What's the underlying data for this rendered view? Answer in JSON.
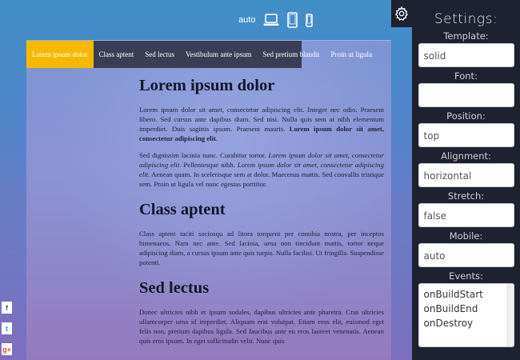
{
  "device_bar": {
    "auto_label": "auto",
    "icons": [
      "desktop-icon",
      "tablet-icon",
      "phone-icon"
    ]
  },
  "menu": {
    "items": [
      {
        "label": "Lorem ipsum dolor",
        "active": true
      },
      {
        "label": "Class aptent",
        "active": false
      },
      {
        "label": "Sed lectus",
        "active": false
      },
      {
        "label": "Vestibulum ante ipsum",
        "active": false
      },
      {
        "label": "Sed pretium blandit",
        "active": false
      },
      {
        "label": "Proin ut ligula",
        "active": false
      }
    ],
    "active_color": "#f6b900",
    "bar_color": "#3b3d55"
  },
  "article": {
    "s1": {
      "heading": "Lorem ipsum dolor",
      "p1_text": "Lorem ipsum dolor sit amet, consectetur adipiscing elit. Integer nec odio. Praesent libero. Sed cursus ante dapibus diam. Sed nisi. Nulla quis sem at nibh elementum imperdiet. Duis sagittis ipsum. Praesent mauris. ",
      "p1_bold": "Lorem ipsum dolor sit amet, consectetur adipiscing elit",
      "p1_end": ".",
      "p2_start": "Sed dignissim lacinia nunc. Curabitur tortor. ",
      "p2_em1": "Lorem ipsum dolor sit amet, consectetur adipiscing elit.",
      "p2_mid": " Pellentesque nibh. ",
      "p2_em2": "Lorem ipsum dolor sit amet, consectetur adipiscing elit.",
      "p2_end": " Aenean quam. In scelerisque sem at dolor. Maecenas mattis. Sed convallis tristique sem. Proin ut ligula vel nunc egestas porttitor."
    },
    "s2": {
      "heading": "Class aptent",
      "p1": "Class aptent taciti sociosqu ad litora torquent per conubia nostra, per inceptos himenaeos. Nam nec ante. Sed lacinia, urna non tincidunt mattis, tortor neque adipiscing diam, a cursus ipsum ante quis turpis. Nulla facilisi. Ut fringilla. Suspendisse potenti."
    },
    "s3": {
      "heading": "Sed lectus",
      "p1": "Donec ultricies nibh et ipsum sodales, dapibus ultricies ante pharetra. Cras ultricies ullamcorper urna id imperdiet. Aliquam erat volutpat. Etiam eros elit, euismod eget felis non, pretium dapibus ligula. Sed faucibus ante eu eros laoreet venenatis. Aenean quis eros ipsum. In eget sollicitudin velit. Nunc quis"
    }
  },
  "settings": {
    "title": "Settings:",
    "template": {
      "label": "Template:",
      "value": "solid"
    },
    "font": {
      "label": "Font:",
      "value": ""
    },
    "position": {
      "label": "Position:",
      "value": "top"
    },
    "alignment": {
      "label": "Alignment:",
      "value": "horizontal"
    },
    "stretch": {
      "label": "Stretch:",
      "value": "false"
    },
    "mobile": {
      "label": "Mobile:",
      "value": "auto"
    },
    "events": {
      "label": "Events:",
      "values": [
        "onBuildStart",
        "onBuildEnd",
        "onDestroy"
      ]
    }
  },
  "social": {
    "items": [
      {
        "icon": "facebook-icon",
        "glyph": "f",
        "color": "#3b5998"
      },
      {
        "icon": "twitter-icon",
        "glyph": "t",
        "color": "#1da1f2"
      },
      {
        "icon": "google-plus-icon",
        "glyph": "g+",
        "color": "#dd4b39"
      }
    ]
  }
}
